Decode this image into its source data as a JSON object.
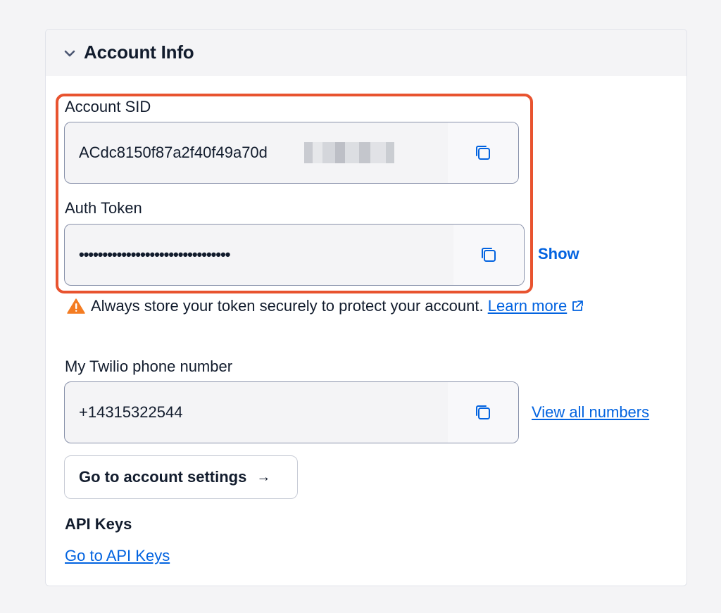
{
  "card": {
    "title": "Account Info"
  },
  "account_sid": {
    "label": "Account SID",
    "value": "ACdc8150f87a2f40f49a70d"
  },
  "auth_token": {
    "label": "Auth Token",
    "value": "••••••••••••••••••••••••••••••••",
    "show_label": "Show"
  },
  "warning": {
    "text": "Always store your token securely to protect your account.",
    "link_label": "Learn more"
  },
  "phone": {
    "label": "My Twilio phone number",
    "value": "+14315322544",
    "view_all_label": "View all numbers"
  },
  "settings_button": {
    "label": "Go to account settings",
    "arrow": "→"
  },
  "api_keys": {
    "heading": "API Keys",
    "link_label": "Go to API Keys"
  },
  "colors": {
    "accent_link": "#0263e0",
    "highlight": "#e8532f",
    "warning": "#f47c22"
  }
}
